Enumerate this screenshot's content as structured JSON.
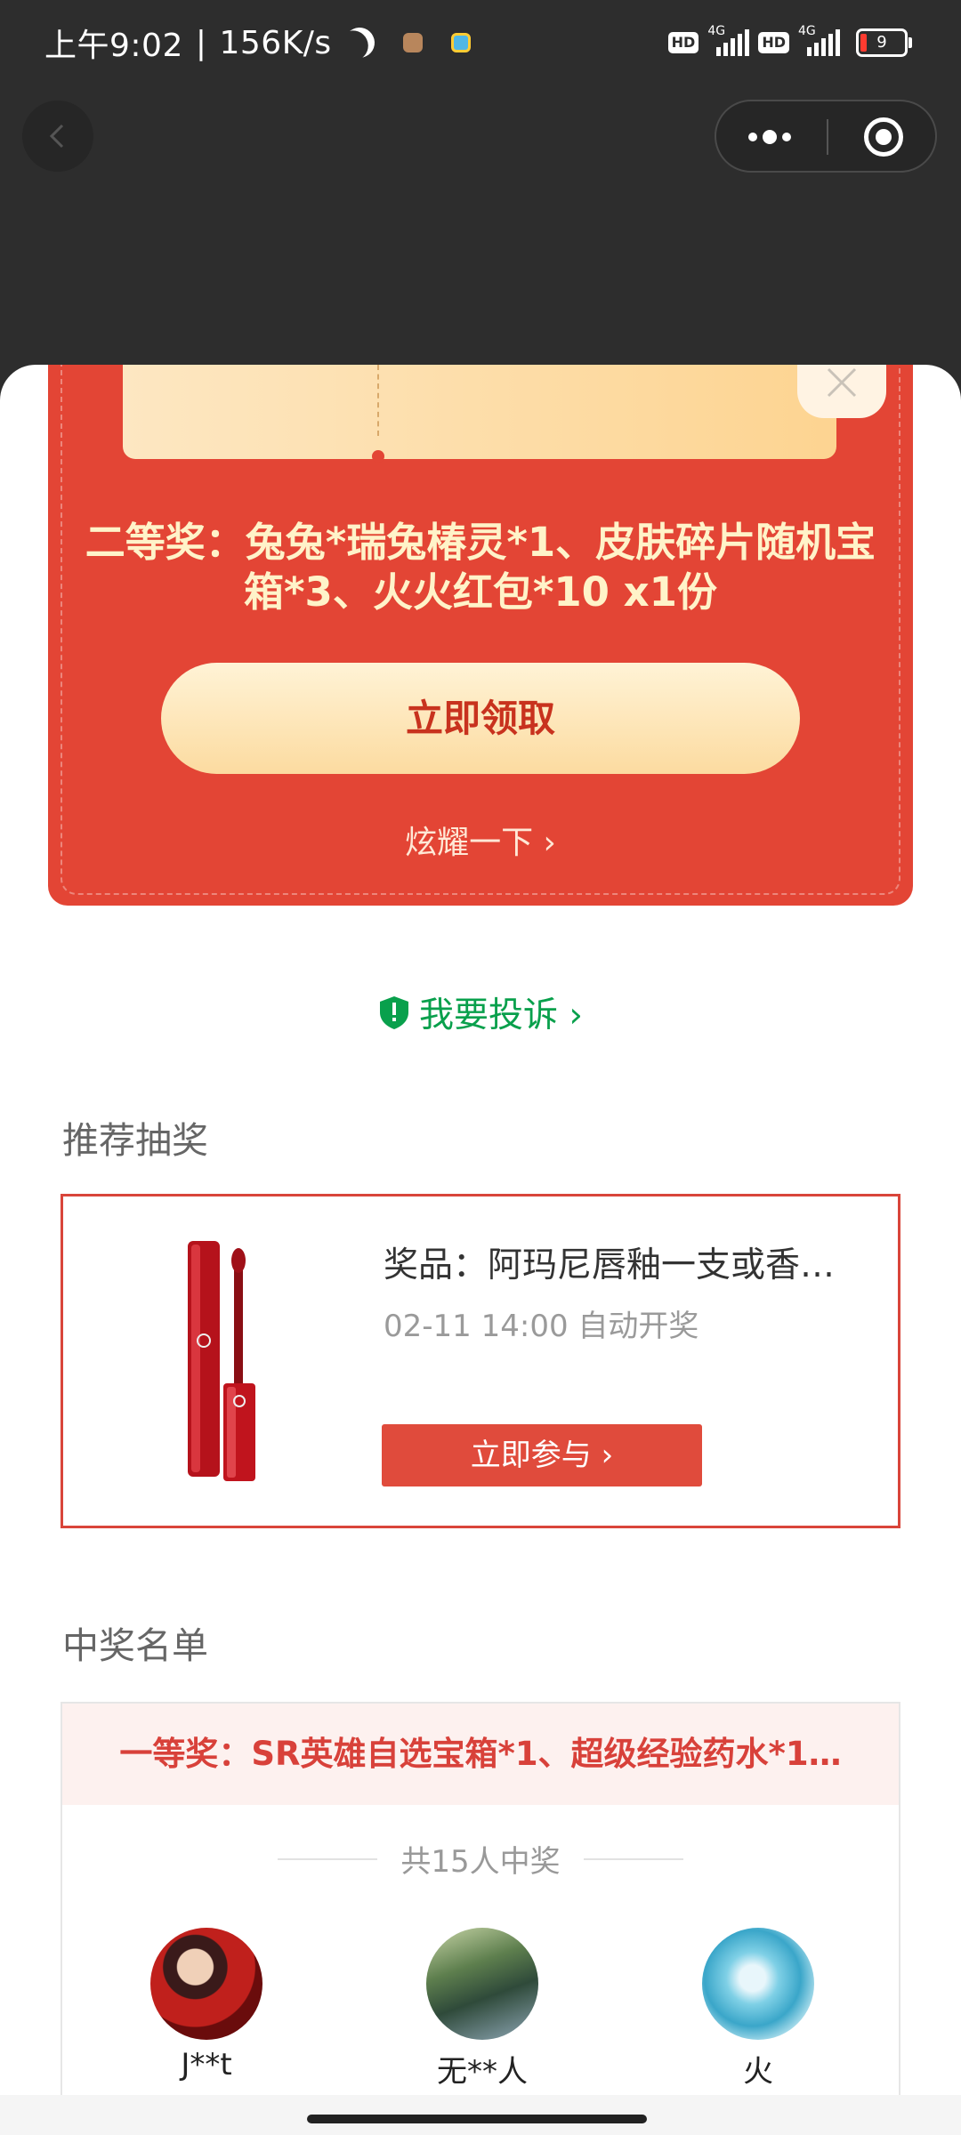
{
  "status_bar": {
    "time": "上午9:02",
    "speed": "156K/s",
    "network_tag_1": "4G",
    "network_tag_2": "4G",
    "hd_label": "HD",
    "battery": "9"
  },
  "nav": {
    "back_icon": "chevron-left-icon",
    "more_icon": "more-dots-icon",
    "close_icon": "target-circle-icon"
  },
  "prize": {
    "title": "二等奖：兔兔*瑞兔椿灵*1、皮肤碎片随机宝箱*3、火火红包*10 x1份",
    "claim_label": "立即领取",
    "show_off_label": "炫耀一下 ›"
  },
  "complain": {
    "label": "我要投诉 ›",
    "icon": "shield-exclamation-icon",
    "color": "#09a04c"
  },
  "recommend": {
    "section_title": "推荐抽奖",
    "prize_text": "奖品：阿玛尼唇釉一支或香…",
    "draw_time": "02-11 14:00 自动开奖",
    "join_label": "立即参与 ›",
    "image_icon": "lipstick-product-image"
  },
  "winners": {
    "section_title": "中奖名单",
    "first_prize": "一等奖：SR英雄自选宝箱*1、超级经验药水*1…",
    "count_label": "共15人中奖",
    "list": [
      {
        "name": "J**t"
      },
      {
        "name": "无**人"
      },
      {
        "name": "火"
      }
    ]
  },
  "colors": {
    "prize_card": "#e34535",
    "accent_red": "#d9453a",
    "complain_green": "#09a04c"
  }
}
